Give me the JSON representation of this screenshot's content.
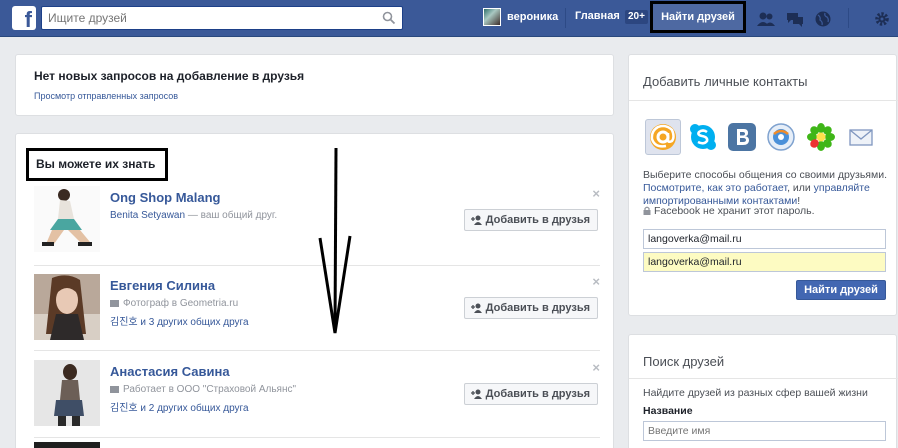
{
  "topbar": {
    "logo_letter": "f",
    "search_placeholder": "Ищите друзей",
    "user_name": "вероника",
    "home_label": "Главная",
    "home_badge": "20+",
    "find_friends_label": "Найти друзей"
  },
  "requests": {
    "title": "Нет новых запросов на добавление в друзья",
    "sent_link": "Просмотр отправленных запросов"
  },
  "suggestions": {
    "heading": "Вы можете их знать",
    "add_label": "Добавить в друзья",
    "close_glyph": "×",
    "people": [
      {
        "name": "Ong Shop Malang",
        "line1_link": "Benita Setyawan",
        "line1_text": " — ваш общий друг.",
        "line2_link": "",
        "line2_text": ""
      },
      {
        "name": "Евгения Силина",
        "line1_link": "",
        "line1_text": "Фотограф в Geometria.ru",
        "line2_link": "김진호",
        "line2_text": " и 3 других общих друга"
      },
      {
        "name": "Анастасия Савина",
        "line1_link": "",
        "line1_text": "Работает в ООО \"Страховой Альянс\"",
        "line2_link": "김진호",
        "line2_text": " и 2 других общих друга"
      }
    ]
  },
  "contacts": {
    "title": "Добавить личные контакты",
    "services": [
      "mail-ru-icon",
      "skype-icon",
      "vkontakte-icon",
      "windows-live-icon",
      "icq-icon",
      "email-icon"
    ],
    "desc_1": "Выберите способы общения со своими друзьями. ",
    "desc_link_1": "Посмотрите, как это работает",
    "desc_2": ", или ",
    "desc_link_2": "управляйте импортированными контактами",
    "desc_3": "!",
    "lock_note": "Facebook не хранит этот пароль.",
    "email_value": "langoverka@mail.ru",
    "email_value_2": "langoverka@mail.ru",
    "find_button": "Найти друзей"
  },
  "search_friends": {
    "title": "Поиск друзей",
    "subtitle": "Найдите друзей из разных сфер вашей жизни",
    "name_label": "Название",
    "name_placeholder": "Введите имя"
  },
  "colors": {
    "brand": "#3b5998",
    "link": "#365899",
    "button": "#4267b2"
  }
}
